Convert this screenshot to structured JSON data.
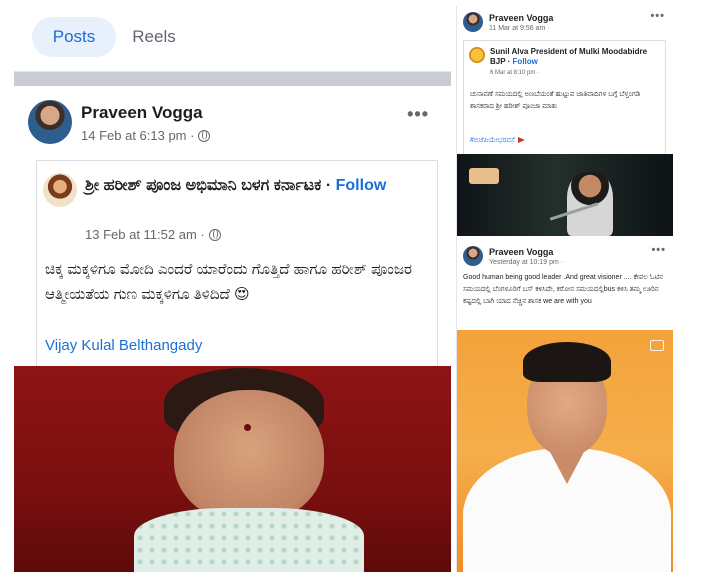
{
  "left_post": {
    "tabs": {
      "posts": "Posts",
      "reels": "Reels"
    },
    "author": "Praveen Vogga",
    "timestamp": "14 Feb at 6:13 pm ·",
    "more": "•••",
    "shared": {
      "title": "ಶ್ರೀ ಹರೀಶ್ ಪೂಂಜ ಅಭಿಮಾನಿ ಬಳಗ ಕರ್ನಾಟಕ",
      "follow": "Follow",
      "timestamp": "13 Feb at 11:52 am ·",
      "body": "ಚಿಕ್ಕ ಮಕ್ಕಳಿಗೂ ಮೋದಿ ಎಂದರೆ ಯಾರೆಂದು ಗೊತ್ತಿದೆ ಹಾಗೂ ಹರೀಶ್ ಪೂಂಜರ ಆತ್ಮೀಯತೆಯ ಗುಣ ಮಕ್ಕಳಿಗೂ ತಿಳಿದಿದೆ 😍",
      "signature": "Vijay Kulal Belthangady"
    }
  },
  "right_post1": {
    "author": "Praveen Vogga",
    "timestamp": "11 Mar at 9:56 am ·",
    "more": "•••",
    "shared": {
      "title": "Sunil Alva President of Mulki Moodabidre BJP",
      "follow": "Follow",
      "timestamp": "6 Mar at 8:10 pm ·",
      "body": "ಚುನಾವಣೆ ಸಮಯದಲ್ಲಿ ಅಣಬೆಯಂತೆ ಹುಟ್ಟುವ ಜಾತಿವಾದಿಗಳ ಬಗ್ಗೆ ಬೆಳ್ತಂಗಡಿ ಶಾಸಕರಾದ ಶ್ರೀ ಹರೀಶ್ ಪೂಂಜಾ ಮಾತು",
      "hashtag": "#ಬಿಜೆಪಿಯೇಭರವಸೆ"
    }
  },
  "right_post2": {
    "author": "Praveen Vogga",
    "timestamp": "Yesterday at 10:19 pm ·",
    "more": "•••",
    "body": "Good human being good leader .And great visioner .... ಕೇವಲ ಓಟಿನ ಸಮಯದಲ್ಲಿ ಬೆಂಗಳೂರಿಗೆ ಬಸ್ ಕಳಿಸಿದೇ, ಕರೋನ ಸಮಯದಲ್ಲಿbus ಕಳಿಸಿ ತಮ್ಮ ಊರಿನ ಕಷ್ಟದಲ್ಲಿ ಬಾಗಿ ಯಾದ ನೆಚ್ಚಿನ ಶಾಸಕ  we are with you"
  },
  "colors": {
    "accent": "#1a6fd6",
    "tab_active_bg": "#e7f0fb",
    "meta_text": "#65676b",
    "divider": "#c9ccd1"
  },
  "icons": [
    "globe-icon",
    "more-icon",
    "cast-icon",
    "emoji-heart-eyes"
  ]
}
